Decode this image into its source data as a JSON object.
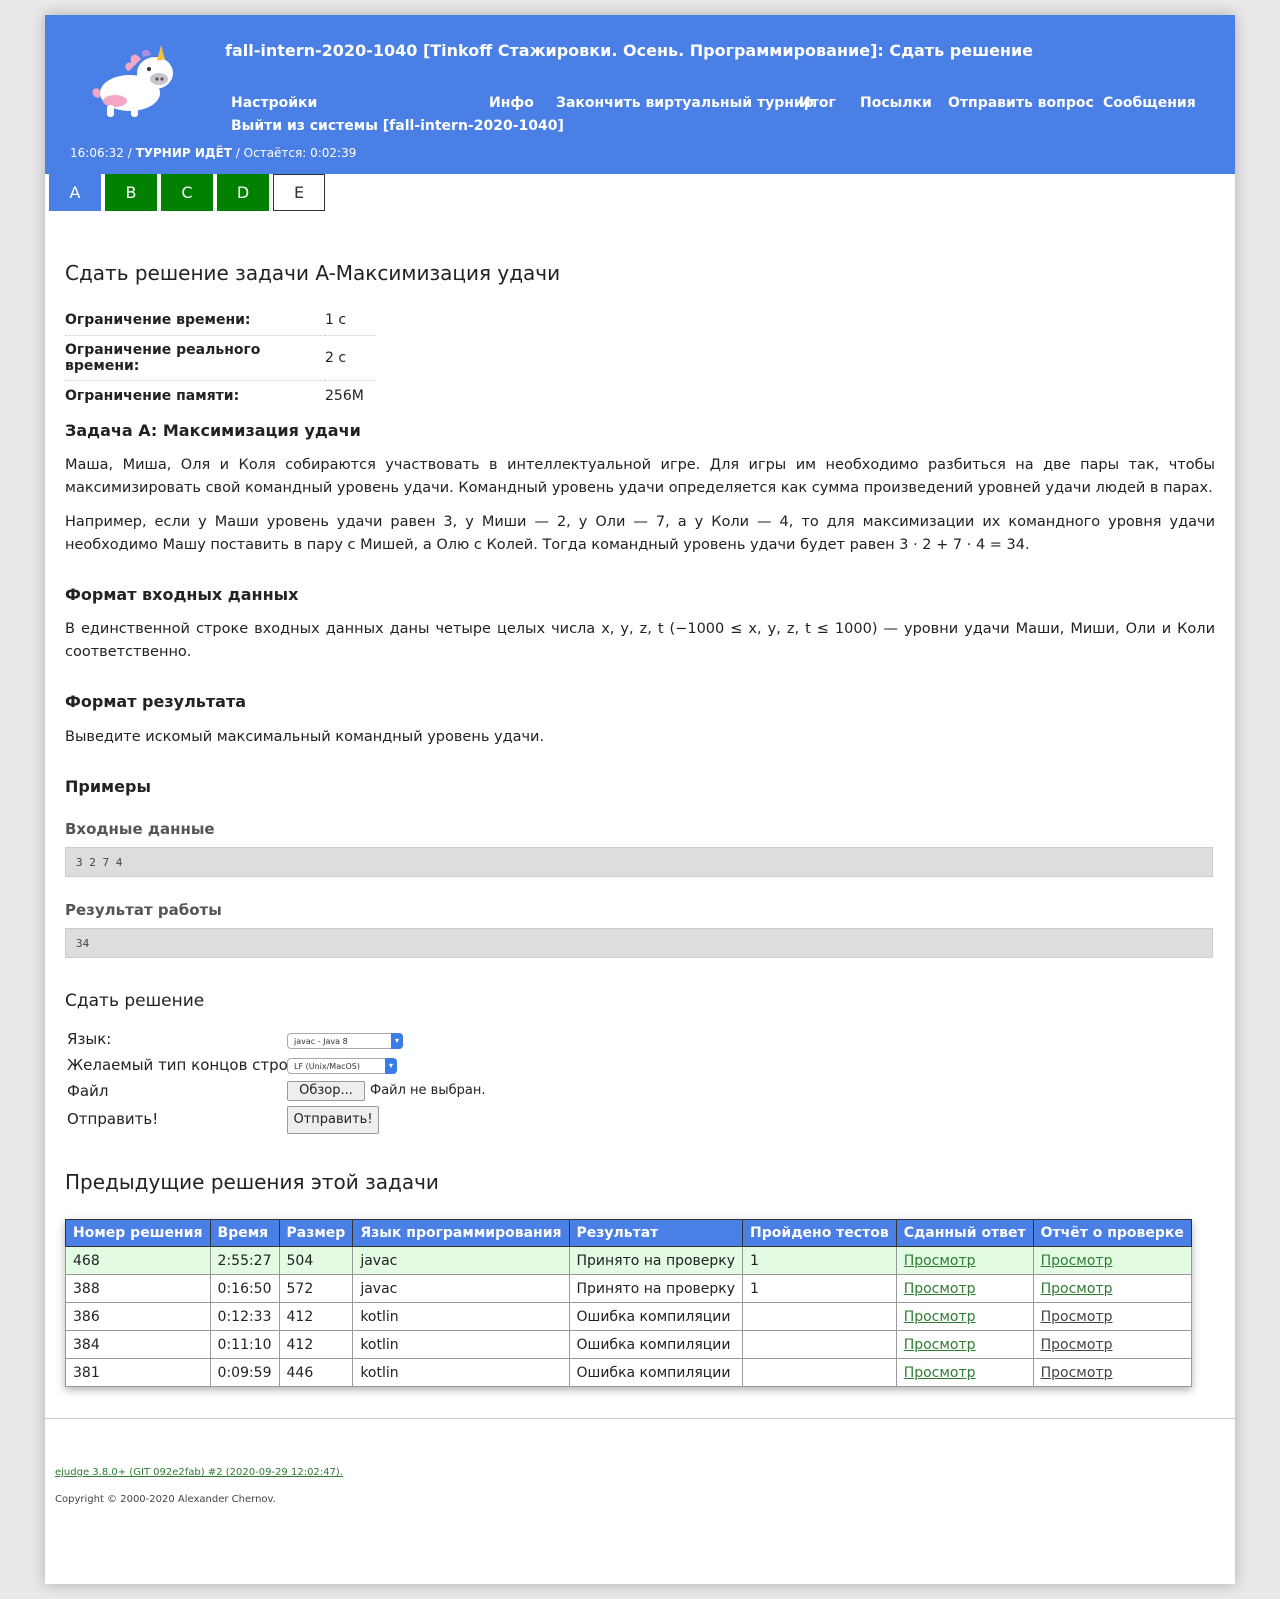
{
  "header": {
    "title": "fall-intern-2020-1040 [Tinkoff Стажировки. Осень. Программирование]: Сдать решение",
    "nav": {
      "settings": "Настройки",
      "info": "Инфо",
      "finish_virtual": "Закончить виртуальный турнир",
      "summary": "Итог",
      "runs": "Посылки",
      "ask_question": "Отправить вопрос",
      "messages": "Сообщения",
      "logout": "Выйти из системы [fall-intern-2020-1040]"
    },
    "status": {
      "time": "16:06:32",
      "sep1": " / ",
      "state": "ТУРНИР ИДЁТ",
      "sep2": " / ",
      "remaining": "Остаётся: 0:02:39"
    }
  },
  "tabs": [
    {
      "label": "A",
      "state": "active"
    },
    {
      "label": "B",
      "state": "solved"
    },
    {
      "label": "C",
      "state": "solved"
    },
    {
      "label": "D",
      "state": "solved"
    },
    {
      "label": "E",
      "state": "empty"
    }
  ],
  "problem": {
    "heading": "Сдать решение задачи A-Максимизация удачи",
    "limits": [
      {
        "label": "Ограничение времени:",
        "value": "1 с"
      },
      {
        "label": "Ограничение реального времени:",
        "value": "2 с"
      },
      {
        "label": "Ограничение памяти:",
        "value": "256M"
      }
    ],
    "title": "Задача A: Максимизация удачи",
    "statement_1": "Маша, Миша, Оля и Коля собираются участвовать в интеллектуальной игре. Для игры им необходимо разбиться на две пары так, чтобы максимизировать свой командный уровень удачи. Командный уровень удачи определяется как сумма произведений уровней удачи людей в парах.",
    "statement_2": "Например, если у Маши уровень удачи равен 3, у Миши — 2, у Оли — 7, а у Коли — 4, то для максимизации их командного уровня удачи необходимо Машу поставить в пару с Мишей, а Олю с Колей. Тогда командный уровень удачи будет равен 3 · 2 + 7 · 4 = 34.",
    "input_heading": "Формат входных данных",
    "input_text": "В единственной строке входных данных даны четыре целых числа x, y, z, t (−1000 ≤ x, y, z, t ≤ 1000) — уровни удачи Маши, Миши, Оли и Коли соответственно.",
    "output_heading": "Формат результата",
    "output_text": "Выведите искомый максимальный командный уровень удачи.",
    "examples_heading": "Примеры",
    "example_input_label": "Входные данные",
    "example_input": "3 2 7 4",
    "example_output_label": "Результат работы",
    "example_output": "34"
  },
  "submit": {
    "heading": "Сдать решение",
    "language_label": "Язык:",
    "language_value": "javac - Java 8",
    "eol_label": "Желаемый тип концов строк:",
    "eol_value": "LF (Unix/MacOS)",
    "file_label": "Файл",
    "browse_button": "Обзор...",
    "file_status": "Файл не выбран.",
    "send_label": "Отправить!",
    "send_button": "Отправить!"
  },
  "previous": {
    "heading": "Предыдущие решения этой задачи",
    "columns": [
      "Номер решения",
      "Время",
      "Размер",
      "Язык программирования",
      "Результат",
      "Пройдено тестов",
      "Сданный ответ",
      "Отчёт о проверке"
    ],
    "rows": [
      {
        "id": "468",
        "time": "2:55:27",
        "size": "504",
        "lang": "javac",
        "result": "Принято на проверку",
        "tests": "1",
        "answer": "Просмотр",
        "report": "Просмотр"
      },
      {
        "id": "388",
        "time": "0:16:50",
        "size": "572",
        "lang": "javac",
        "result": "Принято на проверку",
        "tests": "1",
        "answer": "Просмотр",
        "report": "Просмотр"
      },
      {
        "id": "386",
        "time": "0:12:33",
        "size": "412",
        "lang": "kotlin",
        "result": "Ошибка компиляции",
        "tests": "",
        "answer": "Просмотр",
        "report": "Просмотр"
      },
      {
        "id": "384",
        "time": "0:11:10",
        "size": "412",
        "lang": "kotlin",
        "result": "Ошибка компиляции",
        "tests": "",
        "answer": "Просмотр",
        "report": "Просмотр"
      },
      {
        "id": "381",
        "time": "0:09:59",
        "size": "446",
        "lang": "kotlin",
        "result": "Ошибка компиляции",
        "tests": "",
        "answer": "Просмотр",
        "report": "Просмотр"
      }
    ]
  },
  "footer": {
    "version": "ejudge 3.8.0+ (GIT 092e2fab) #2 (2020-09-29 12:02:47).",
    "copyright": "Copyright © 2000-2020 Alexander Chernov."
  },
  "colors": {
    "header_bg": "#4a7fe5",
    "tab_solved": "#008000",
    "row_highlight": "#e3fbe3"
  }
}
